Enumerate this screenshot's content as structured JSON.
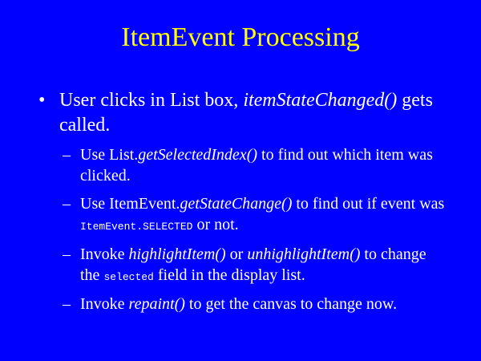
{
  "slide": {
    "title": "ItemEvent Processing",
    "bullet": {
      "marker": "•",
      "t1": "User clicks in List box, ",
      "t1_italic": "itemStateChanged()",
      "t1_end": " gets called."
    },
    "sub_marker": "–",
    "sub1": {
      "t1": "Use List.",
      "t1_italic": "getSelectedIndex()",
      "t1_end": " to find out which item was clicked."
    },
    "sub2": {
      "t1": "Use ItemEvent.",
      "t1_italic": "getStateChange()",
      "t1_mid": " to find out if event was ",
      "t1_code": "ItemEvent.SELECTED",
      "t1_end": " or not."
    },
    "sub3": {
      "t1": "Invoke ",
      "t1_italic": "highlightItem()",
      "t1_mid": " or ",
      "t1_italic2": "unhighlightItem()",
      "t1_mid2": " to change the ",
      "t1_code": "selected",
      "t1_end": " field in the display list."
    },
    "sub4": {
      "t1": "Invoke ",
      "t1_italic": "repaint()",
      "t1_end": " to get the canvas to change now."
    }
  }
}
